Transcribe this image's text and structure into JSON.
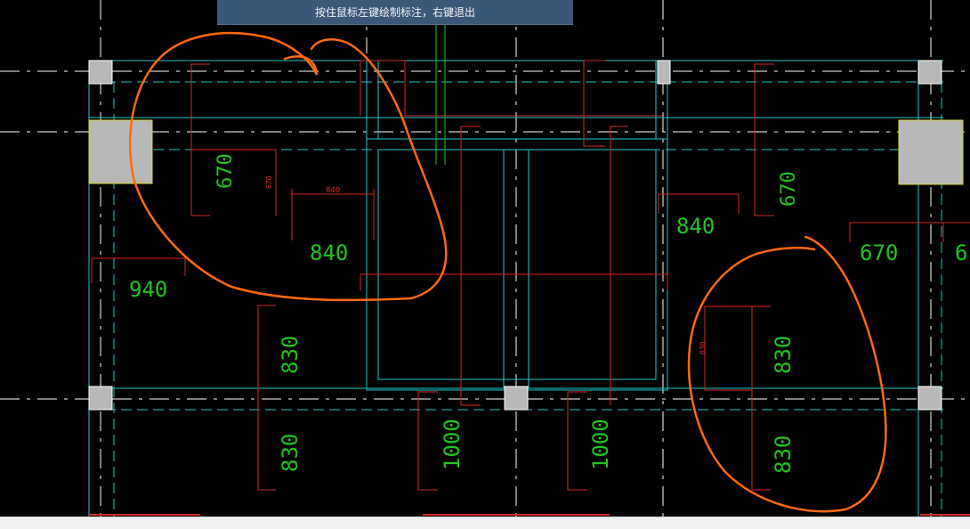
{
  "hint_bar": {
    "text": "按住鼠标左键绘制标注，右键退出"
  },
  "colors": {
    "background": "#000000",
    "axis_white": "#ffffff",
    "beam_cyan": "#22c7c7",
    "dim_red": "#d42a2a",
    "text_green": "#22c422",
    "column_fill": "#b8b8b8",
    "markup_orange": "#ff6a10",
    "hint_bg": "#3d5778"
  },
  "dimensions": {
    "d670_left": "670",
    "d670_small": "670",
    "d840_small": "840",
    "d840_left": "840",
    "d940": "940",
    "d830_a": "830",
    "d830_b": "830",
    "d1000_a": "1000",
    "d1000_b": "1000",
    "d840_mid": "840",
    "d670_upper_right": "670",
    "d670_right": "670",
    "d6_edge": "6",
    "d830_small_right": "830",
    "d830_c": "830",
    "d830_d": "830"
  }
}
